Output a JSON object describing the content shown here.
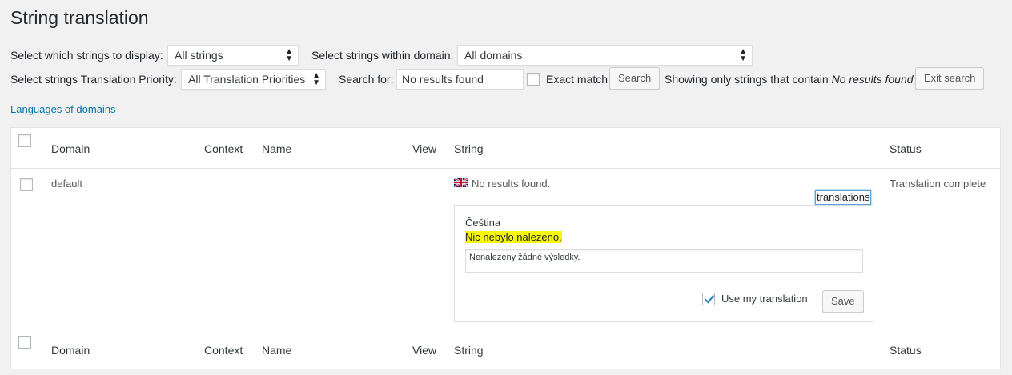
{
  "page": {
    "title": "String translation"
  },
  "filters": {
    "display_label": "Select which strings to display:",
    "display_value": "All strings",
    "domain_label": "Select strings within domain:",
    "domain_value": "All domains",
    "priority_label": "Select strings Translation Priority:",
    "priority_value": "All Translation Priorities",
    "search_label": "Search for:",
    "search_value": "No results found",
    "exact_match_label": "Exact match",
    "search_button": "Search",
    "showing_prefix": "Showing only strings that contain",
    "showing_term": "No results found",
    "exit_button": "Exit search"
  },
  "links": {
    "languages_of_domains": "Languages of domains"
  },
  "table": {
    "headers": {
      "domain": "Domain",
      "context": "Context",
      "name": "Name",
      "view": "View",
      "string": "String",
      "status": "Status"
    },
    "rows": [
      {
        "domain": "default",
        "string": "No results found.",
        "translations_button": "translations",
        "status": "Translation complete",
        "translation": {
          "language": "Čeština",
          "current": "Nic nebylo nalezeno.",
          "suggested": "Nenalezeny žádné výsledky.",
          "use_my_translation": "Use my translation",
          "save_button": "Save"
        }
      }
    ]
  },
  "colors": {
    "link": "#0073aa",
    "highlight": "#f7f70a",
    "focus": "#5b9dd9"
  }
}
